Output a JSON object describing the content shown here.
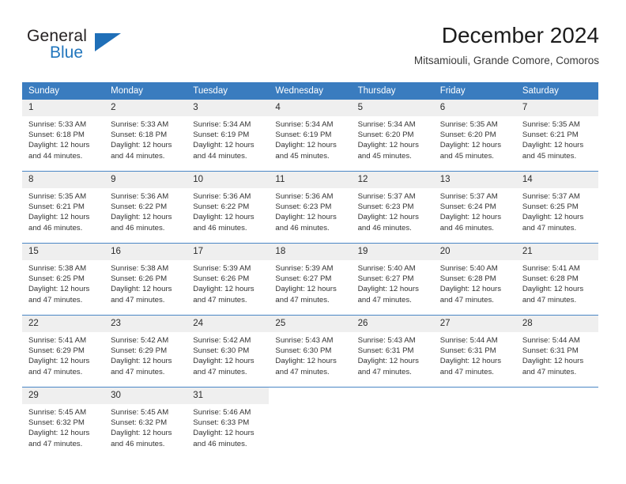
{
  "brand": {
    "name_top": "General",
    "name_bottom": "Blue",
    "triangle_icon": "triangle-icon",
    "accent_color": "#2176bd"
  },
  "header": {
    "title": "December 2024",
    "subtitle": "Mitsamiouli, Grande Comore, Comoros"
  },
  "colors": {
    "header_blue": "#3a7cbf",
    "daynum_gray": "#efefef",
    "row_divider": "#4a86c5"
  },
  "weekdays": [
    "Sunday",
    "Monday",
    "Tuesday",
    "Wednesday",
    "Thursday",
    "Friday",
    "Saturday"
  ],
  "weeks": [
    [
      {
        "day": "1",
        "sunrise": "Sunrise: 5:33 AM",
        "sunset": "Sunset: 6:18 PM",
        "daylight1": "Daylight: 12 hours",
        "daylight2": "and 44 minutes."
      },
      {
        "day": "2",
        "sunrise": "Sunrise: 5:33 AM",
        "sunset": "Sunset: 6:18 PM",
        "daylight1": "Daylight: 12 hours",
        "daylight2": "and 44 minutes."
      },
      {
        "day": "3",
        "sunrise": "Sunrise: 5:34 AM",
        "sunset": "Sunset: 6:19 PM",
        "daylight1": "Daylight: 12 hours",
        "daylight2": "and 44 minutes."
      },
      {
        "day": "4",
        "sunrise": "Sunrise: 5:34 AM",
        "sunset": "Sunset: 6:19 PM",
        "daylight1": "Daylight: 12 hours",
        "daylight2": "and 45 minutes."
      },
      {
        "day": "5",
        "sunrise": "Sunrise: 5:34 AM",
        "sunset": "Sunset: 6:20 PM",
        "daylight1": "Daylight: 12 hours",
        "daylight2": "and 45 minutes."
      },
      {
        "day": "6",
        "sunrise": "Sunrise: 5:35 AM",
        "sunset": "Sunset: 6:20 PM",
        "daylight1": "Daylight: 12 hours",
        "daylight2": "and 45 minutes."
      },
      {
        "day": "7",
        "sunrise": "Sunrise: 5:35 AM",
        "sunset": "Sunset: 6:21 PM",
        "daylight1": "Daylight: 12 hours",
        "daylight2": "and 45 minutes."
      }
    ],
    [
      {
        "day": "8",
        "sunrise": "Sunrise: 5:35 AM",
        "sunset": "Sunset: 6:21 PM",
        "daylight1": "Daylight: 12 hours",
        "daylight2": "and 46 minutes."
      },
      {
        "day": "9",
        "sunrise": "Sunrise: 5:36 AM",
        "sunset": "Sunset: 6:22 PM",
        "daylight1": "Daylight: 12 hours",
        "daylight2": "and 46 minutes."
      },
      {
        "day": "10",
        "sunrise": "Sunrise: 5:36 AM",
        "sunset": "Sunset: 6:22 PM",
        "daylight1": "Daylight: 12 hours",
        "daylight2": "and 46 minutes."
      },
      {
        "day": "11",
        "sunrise": "Sunrise: 5:36 AM",
        "sunset": "Sunset: 6:23 PM",
        "daylight1": "Daylight: 12 hours",
        "daylight2": "and 46 minutes."
      },
      {
        "day": "12",
        "sunrise": "Sunrise: 5:37 AM",
        "sunset": "Sunset: 6:23 PM",
        "daylight1": "Daylight: 12 hours",
        "daylight2": "and 46 minutes."
      },
      {
        "day": "13",
        "sunrise": "Sunrise: 5:37 AM",
        "sunset": "Sunset: 6:24 PM",
        "daylight1": "Daylight: 12 hours",
        "daylight2": "and 46 minutes."
      },
      {
        "day": "14",
        "sunrise": "Sunrise: 5:37 AM",
        "sunset": "Sunset: 6:25 PM",
        "daylight1": "Daylight: 12 hours",
        "daylight2": "and 47 minutes."
      }
    ],
    [
      {
        "day": "15",
        "sunrise": "Sunrise: 5:38 AM",
        "sunset": "Sunset: 6:25 PM",
        "daylight1": "Daylight: 12 hours",
        "daylight2": "and 47 minutes."
      },
      {
        "day": "16",
        "sunrise": "Sunrise: 5:38 AM",
        "sunset": "Sunset: 6:26 PM",
        "daylight1": "Daylight: 12 hours",
        "daylight2": "and 47 minutes."
      },
      {
        "day": "17",
        "sunrise": "Sunrise: 5:39 AM",
        "sunset": "Sunset: 6:26 PM",
        "daylight1": "Daylight: 12 hours",
        "daylight2": "and 47 minutes."
      },
      {
        "day": "18",
        "sunrise": "Sunrise: 5:39 AM",
        "sunset": "Sunset: 6:27 PM",
        "daylight1": "Daylight: 12 hours",
        "daylight2": "and 47 minutes."
      },
      {
        "day": "19",
        "sunrise": "Sunrise: 5:40 AM",
        "sunset": "Sunset: 6:27 PM",
        "daylight1": "Daylight: 12 hours",
        "daylight2": "and 47 minutes."
      },
      {
        "day": "20",
        "sunrise": "Sunrise: 5:40 AM",
        "sunset": "Sunset: 6:28 PM",
        "daylight1": "Daylight: 12 hours",
        "daylight2": "and 47 minutes."
      },
      {
        "day": "21",
        "sunrise": "Sunrise: 5:41 AM",
        "sunset": "Sunset: 6:28 PM",
        "daylight1": "Daylight: 12 hours",
        "daylight2": "and 47 minutes."
      }
    ],
    [
      {
        "day": "22",
        "sunrise": "Sunrise: 5:41 AM",
        "sunset": "Sunset: 6:29 PM",
        "daylight1": "Daylight: 12 hours",
        "daylight2": "and 47 minutes."
      },
      {
        "day": "23",
        "sunrise": "Sunrise: 5:42 AM",
        "sunset": "Sunset: 6:29 PM",
        "daylight1": "Daylight: 12 hours",
        "daylight2": "and 47 minutes."
      },
      {
        "day": "24",
        "sunrise": "Sunrise: 5:42 AM",
        "sunset": "Sunset: 6:30 PM",
        "daylight1": "Daylight: 12 hours",
        "daylight2": "and 47 minutes."
      },
      {
        "day": "25",
        "sunrise": "Sunrise: 5:43 AM",
        "sunset": "Sunset: 6:30 PM",
        "daylight1": "Daylight: 12 hours",
        "daylight2": "and 47 minutes."
      },
      {
        "day": "26",
        "sunrise": "Sunrise: 5:43 AM",
        "sunset": "Sunset: 6:31 PM",
        "daylight1": "Daylight: 12 hours",
        "daylight2": "and 47 minutes."
      },
      {
        "day": "27",
        "sunrise": "Sunrise: 5:44 AM",
        "sunset": "Sunset: 6:31 PM",
        "daylight1": "Daylight: 12 hours",
        "daylight2": "and 47 minutes."
      },
      {
        "day": "28",
        "sunrise": "Sunrise: 5:44 AM",
        "sunset": "Sunset: 6:31 PM",
        "daylight1": "Daylight: 12 hours",
        "daylight2": "and 47 minutes."
      }
    ],
    [
      {
        "day": "29",
        "sunrise": "Sunrise: 5:45 AM",
        "sunset": "Sunset: 6:32 PM",
        "daylight1": "Daylight: 12 hours",
        "daylight2": "and 47 minutes."
      },
      {
        "day": "30",
        "sunrise": "Sunrise: 5:45 AM",
        "sunset": "Sunset: 6:32 PM",
        "daylight1": "Daylight: 12 hours",
        "daylight2": "and 46 minutes."
      },
      {
        "day": "31",
        "sunrise": "Sunrise: 5:46 AM",
        "sunset": "Sunset: 6:33 PM",
        "daylight1": "Daylight: 12 hours",
        "daylight2": "and 46 minutes."
      },
      {
        "day": "",
        "sunrise": "",
        "sunset": "",
        "daylight1": "",
        "daylight2": ""
      },
      {
        "day": "",
        "sunrise": "",
        "sunset": "",
        "daylight1": "",
        "daylight2": ""
      },
      {
        "day": "",
        "sunrise": "",
        "sunset": "",
        "daylight1": "",
        "daylight2": ""
      },
      {
        "day": "",
        "sunrise": "",
        "sunset": "",
        "daylight1": "",
        "daylight2": ""
      }
    ]
  ]
}
